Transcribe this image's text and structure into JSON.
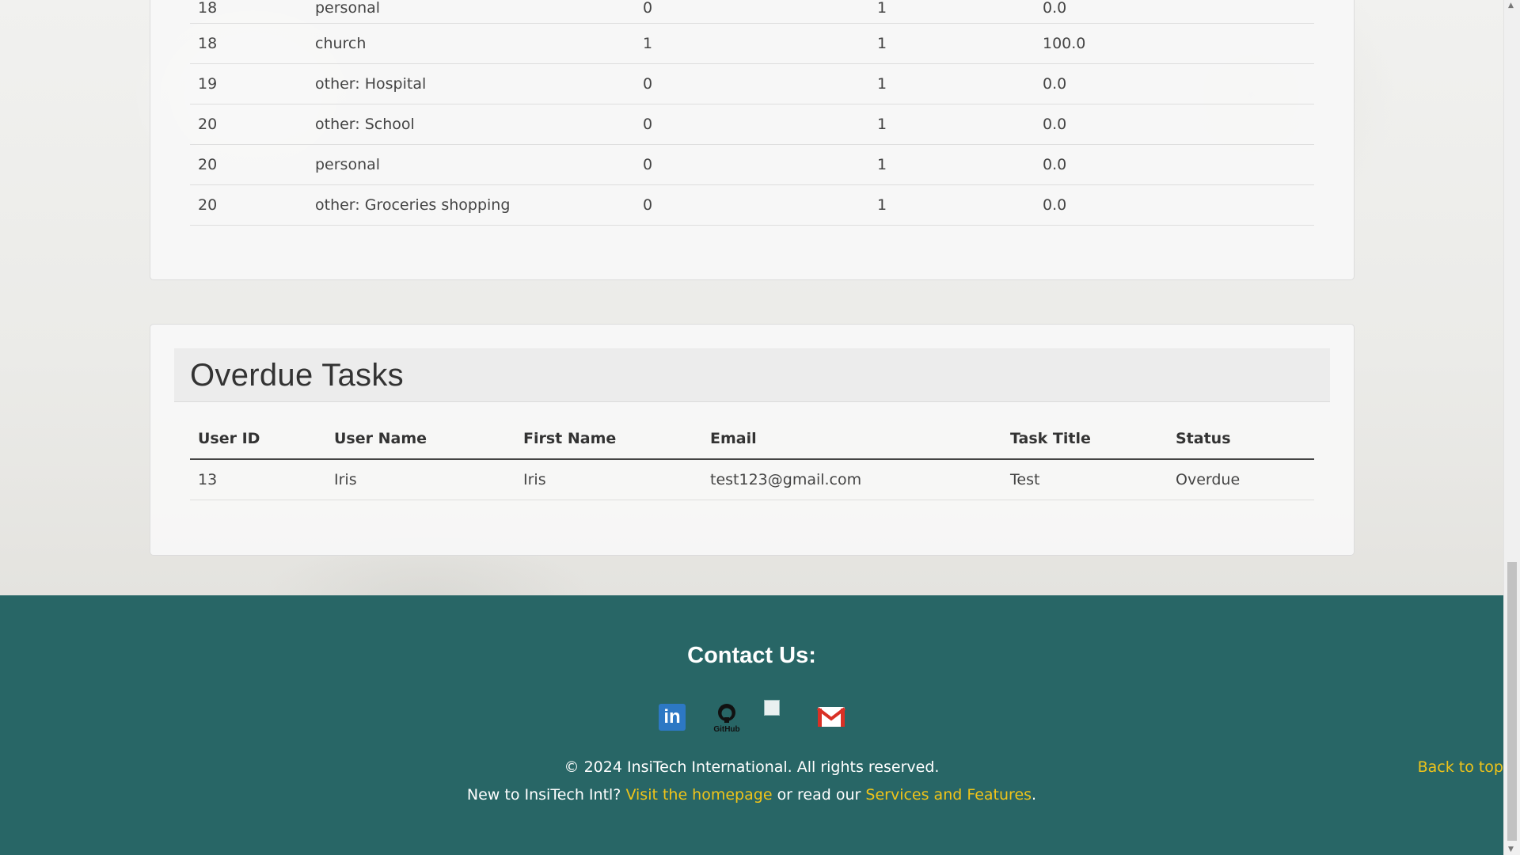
{
  "stats_table": {
    "rows": [
      {
        "id": "18",
        "category": "personal",
        "completed": "0",
        "total": "1",
        "rate": "0.0"
      },
      {
        "id": "18",
        "category": "church",
        "completed": "1",
        "total": "1",
        "rate": "100.0"
      },
      {
        "id": "19",
        "category": "other: Hospital",
        "completed": "0",
        "total": "1",
        "rate": "0.0"
      },
      {
        "id": "20",
        "category": "other: School",
        "completed": "0",
        "total": "1",
        "rate": "0.0"
      },
      {
        "id": "20",
        "category": "personal",
        "completed": "0",
        "total": "1",
        "rate": "0.0"
      },
      {
        "id": "20",
        "category": "other: Groceries shopping",
        "completed": "0",
        "total": "1",
        "rate": "0.0"
      }
    ]
  },
  "overdue": {
    "title": "Overdue Tasks",
    "headers": [
      "User ID",
      "User Name",
      "First Name",
      "Email",
      "Task Title",
      "Status"
    ],
    "rows": [
      {
        "user_id": "13",
        "user_name": "Iris",
        "first_name": "Iris",
        "email": "test123@gmail.com",
        "task_title": "Test",
        "status": "Overdue"
      }
    ]
  },
  "footer": {
    "heading": "Contact Us:",
    "icons": [
      "linkedin-icon",
      "github-icon",
      "broken-image-icon",
      "gmail-icon"
    ],
    "linkedin_glyph": "in",
    "github_label": "GitHub",
    "copyright": "© 2024 InsiTech International. All rights reserved.",
    "new_to": "New to InsiTech Intl?",
    "homepage_link": "Visit the homepage",
    "or_read": "or read our",
    "services_link": "Services and Features",
    "period": ".",
    "back_to_top": "Back to top"
  },
  "colors": {
    "footer_bg": "#286666",
    "link": "#f0c419",
    "linkedin": "#2d78c4",
    "gmail_red": "#d93025"
  }
}
